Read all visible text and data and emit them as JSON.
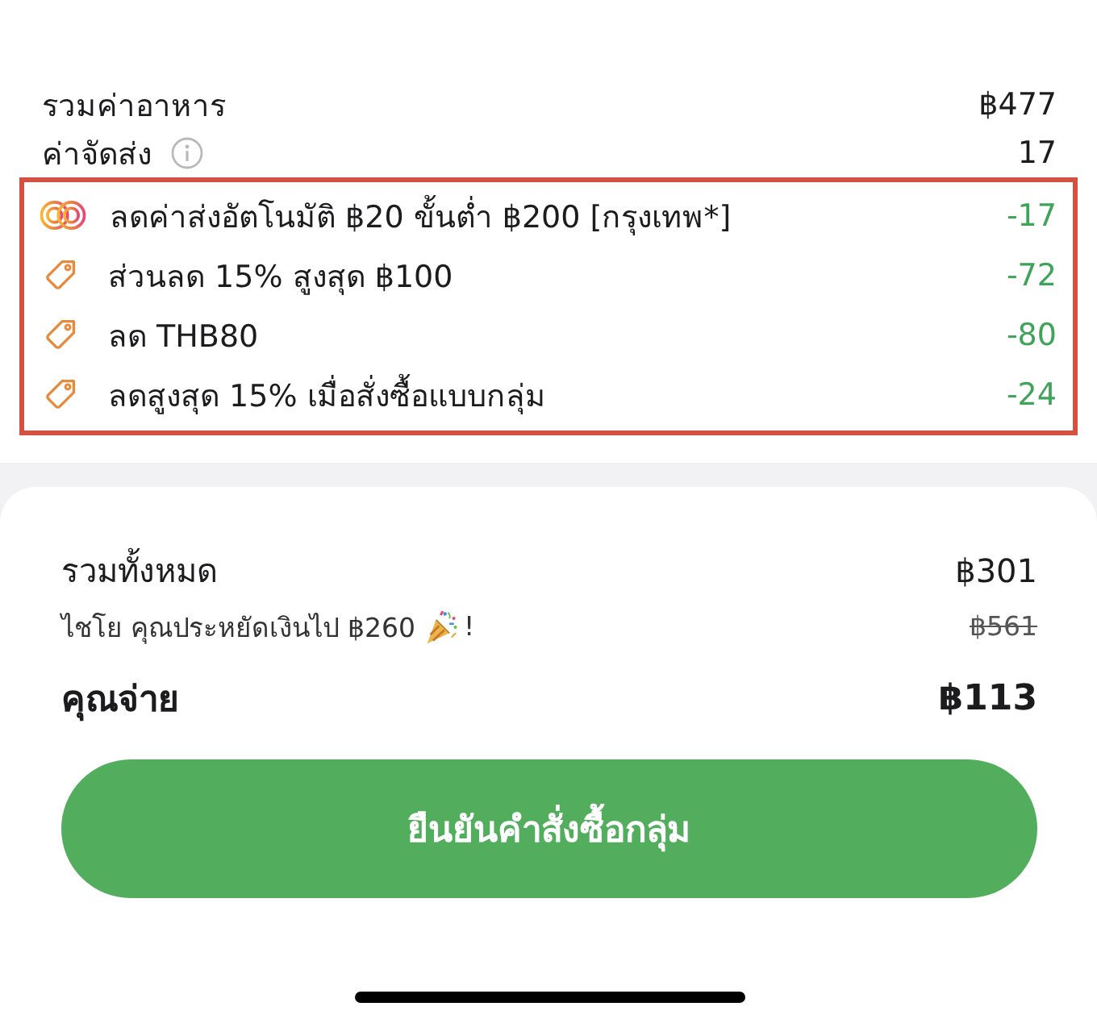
{
  "summary": {
    "rows": [
      {
        "label": "รวมค่าอาหาร",
        "value": "฿477",
        "info": false
      },
      {
        "label": "ค่าจัดส่ง",
        "value": "17",
        "info": true
      }
    ]
  },
  "discounts": {
    "highlighted": true,
    "items": [
      {
        "kind": "delivery",
        "label": "ลดค่าส่งอัตโนมัติ ฿20 ขั้นต่ำ ฿200 [กรุงเทพ*]",
        "value": "-17"
      },
      {
        "kind": "coupon",
        "label": "ส่วนลด 15% สูงสุด ฿100",
        "value": "-72"
      },
      {
        "kind": "coupon",
        "label": "ลด THB80",
        "value": "-80"
      },
      {
        "kind": "coupon",
        "label": "ลดสูงสุด 15% เมื่อสั่งซื้อแบบกลุ่ม",
        "value": "-24"
      }
    ]
  },
  "totals": {
    "total_label": "รวมทั้งหมด",
    "total_value": "฿301",
    "savings_message": "ไชโย คุณประหยัดเงินไป ฿260",
    "savings_suffix": "!",
    "original_total": "฿561",
    "original_struck": true,
    "pay_label": "คุณจ่าย",
    "pay_value": "฿113"
  },
  "confirm_button": {
    "label": "ยืนยันคำสั่งซื้อกลุ่ม"
  }
}
